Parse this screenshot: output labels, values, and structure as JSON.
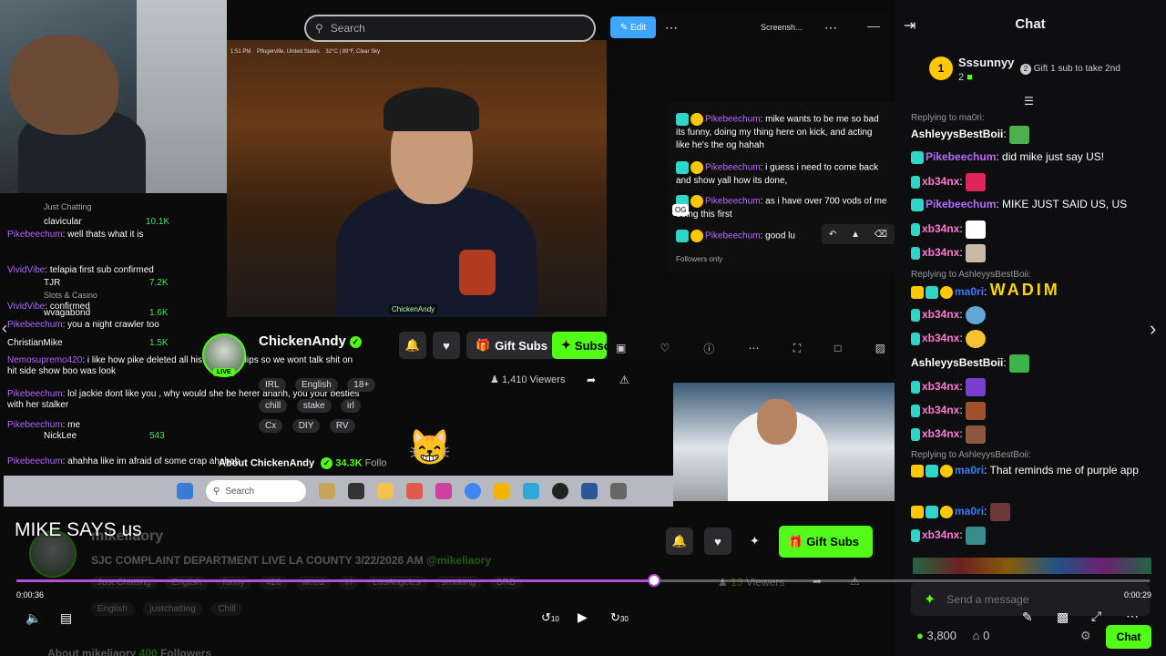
{
  "search": {
    "placeholder": "Search"
  },
  "stream_status": {
    "location": "Pflugerville, United States",
    "weather": "32°C | 89°F, Clear Sky",
    "time": "1:51 PM"
  },
  "video_tag": "ChickenAndy",
  "overlay_chat": [
    {
      "user": "clavicular",
      "value": "10.1K",
      "note": "Just Chatting"
    },
    {
      "user": "Pikebeechum",
      "text": ": well thats what it is"
    },
    {
      "user": "TJR",
      "value": "7.2K",
      "note": "Slots & Casino"
    },
    {
      "user": "VividVibe",
      "text": ": telapia first sub confirmed"
    },
    {
      "user": "VividVibe",
      "text": ": confirmed"
    },
    {
      "user": "wvagabond",
      "value": "1.6K"
    },
    {
      "user": "Pikebeechum",
      "text": ": you a night crawler too"
    },
    {
      "user": "ChristianMike",
      "value": "1.5K"
    },
    {
      "user": "Nemosupremo420",
      "text": ": i like how pike deleted all his odd and clips so we wont talk shit on hit side show boo was look"
    },
    {
      "user": "Pikebeechum",
      "text": ": lol jackie dont like you , why would she be herer ahahh, you your besties with her stalker"
    },
    {
      "user": "Pikebeechum",
      "text": ": me"
    },
    {
      "user": "NickLee",
      "value": "543"
    },
    {
      "user": "Pikebeechum",
      "text": ": ahahha like im afraid of some crap ahahah"
    }
  ],
  "channel": {
    "name": "ChickenAndy",
    "live": "LIVE",
    "tags": [
      "IRL",
      "English",
      "18+",
      "chill",
      "stake",
      "irl",
      "Cx",
      "DIY",
      "RV"
    ],
    "gift_label": "Gift Subs",
    "sub_label": "Subsc",
    "viewers_label": "Viewers",
    "viewers": "1,410",
    "followers": "34.3K",
    "followers_label": "Follo",
    "about_line": "About ChickenAndy"
  },
  "popup": {
    "edit_label": "Edit",
    "title": "Screensh...",
    "og": "OG",
    "followers_only": "Followers only",
    "messages": [
      {
        "user": "Pikebeechum",
        "text": ": mike wants to be me so bad its funny, doing my thing here on kick, and acting like he's the og hahah"
      },
      {
        "user": "Pikebeechum",
        "text": ": i guess i need to come back and show yall how its done,"
      },
      {
        "user": "Pikebeechum",
        "text": ": as i have over 700 vods of me doing this first"
      },
      {
        "user": "Pikebeechum",
        "text": ": good lu"
      }
    ]
  },
  "taskbar": {
    "search": "Search"
  },
  "chat": {
    "title": "Chat",
    "top_gifter": {
      "rank": "1",
      "name": "Sssunnyy",
      "count": "2",
      "tip": "Gift 1 sub to take 2nd"
    },
    "messages": [
      {
        "reply": "Replying to ma0ri:"
      },
      {
        "user": "AshleyysBestBoii",
        "color": "#ffffff",
        "text": ":"
      },
      {
        "user": "Pikebeechum",
        "color": "#b86bff",
        "text": ": did mike just say US!"
      },
      {
        "user": "xb34nx",
        "color": "#ff7bd5",
        "text": ":"
      },
      {
        "user": "Pikebeechum",
        "color": "#b86bff",
        "text": ": MIKE JUST SAID US, US"
      },
      {
        "user": "xb34nx",
        "color": "#ff7bd5",
        "text": ":"
      },
      {
        "user": "xb34nx",
        "color": "#ff7bd5",
        "text": ":"
      },
      {
        "reply": "Replying to AshleyysBestBoii:"
      },
      {
        "user": "ma0ri",
        "color": "#3c7bff",
        "text": ":"
      },
      {
        "user": "xb34nx",
        "color": "#ff7bd5",
        "text": ":"
      },
      {
        "user": "xb34nx",
        "color": "#ff7bd5",
        "text": ":"
      },
      {
        "user": "AshleyysBestBoii",
        "color": "#ffffff",
        "text": ":"
      },
      {
        "user": "xb34nx",
        "color": "#ff7bd5",
        "text": ":"
      },
      {
        "user": "xb34nx",
        "color": "#ff7bd5",
        "text": ":"
      },
      {
        "user": "xb34nx",
        "color": "#ff7bd5",
        "text": ":"
      },
      {
        "reply": "Replying to AshleyysBestBoii:"
      },
      {
        "user": "ma0ri",
        "color": "#3c7bff",
        "text": ": That reminds me of purple app"
      },
      {
        "user": "ma0ri",
        "color": "#3c7bff",
        "text": ":"
      },
      {
        "user": "xb34nx",
        "color": "#ff7bd5",
        "text": ":"
      }
    ],
    "wadim": "WADIM",
    "input_placeholder": "Send a message",
    "points": "3,800",
    "other_count": "0",
    "send_label": "Chat"
  },
  "player": {
    "caption": "MIKE SAYS us",
    "current_time": "0:00:36",
    "total_time": "0:00:29",
    "progress_fraction": 0.563,
    "rewind": "10",
    "forward": "30"
  },
  "lower_channel": {
    "name": "mikeliaory",
    "live": "LIVE",
    "title": "SJC COMPLAINT DEPARTMENT LIVE LA COUNTY 3/22/2026 AM",
    "handle": "@mikeliaory",
    "category": "Just Chatting",
    "tags": [
      "English",
      "funny",
      "420",
      "weed",
      "irl",
      "LosAngeles",
      "smoking",
      "BRB"
    ],
    "tags2": [
      "English",
      "justchatting",
      "Chill"
    ],
    "viewers": "13",
    "viewers_label": "Viewers",
    "gift_label": "Gift Subs",
    "about": "About mikeliaory",
    "followers": "400",
    "followers_label": "Followers"
  },
  "colors": {
    "accent": "#53fc18",
    "progress": "#b34fd6",
    "user_purple": "#b86bff"
  }
}
